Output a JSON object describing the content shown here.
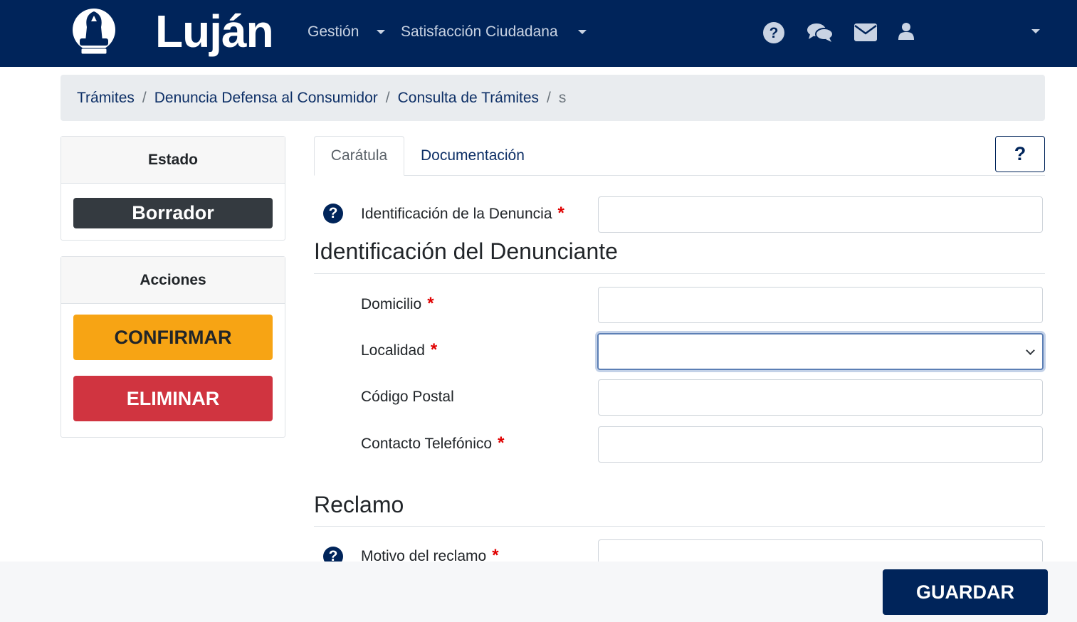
{
  "navbar": {
    "brand": "Luján",
    "menu": [
      {
        "label": "Gestión"
      },
      {
        "label": "Satisfacción Ciudadana"
      }
    ],
    "icons": [
      "help-circle-icon",
      "chat-icon",
      "mail-icon",
      "user-icon",
      "chevron-down-icon"
    ]
  },
  "breadcrumb": {
    "items": [
      "Trámites",
      "Denuncia Defensa al Consumidor",
      "Consulta de Trámites"
    ],
    "active": "s"
  },
  "sidebar": {
    "estado": {
      "title": "Estado",
      "badge": "Borrador"
    },
    "acciones": {
      "title": "Acciones",
      "confirm": "CONFIRMAR",
      "delete": "ELIMINAR"
    }
  },
  "tabs": [
    {
      "label": "Carátula",
      "active": true
    },
    {
      "label": "Documentación",
      "active": false
    }
  ],
  "help_button": "?",
  "form": {
    "identificacion_denuncia": {
      "label": "Identificación de la Denuncia",
      "value": ""
    },
    "section_denunciante": "Identificación del Denunciante",
    "domicilio": {
      "label": "Domicilio",
      "value": ""
    },
    "localidad": {
      "label": "Localidad",
      "value": ""
    },
    "codigo_postal": {
      "label": "Código Postal",
      "value": ""
    },
    "contacto": {
      "label": "Contacto Telefónico",
      "value": ""
    },
    "section_reclamo": "Reclamo",
    "motivo": {
      "label": "Motivo del reclamo",
      "value": ""
    },
    "required_mark": "*"
  },
  "footer": {
    "save": "GUARDAR"
  },
  "colors": {
    "primary": "#00245a",
    "warning": "#f7a414",
    "danger": "#d03440",
    "dark": "#343a40"
  }
}
